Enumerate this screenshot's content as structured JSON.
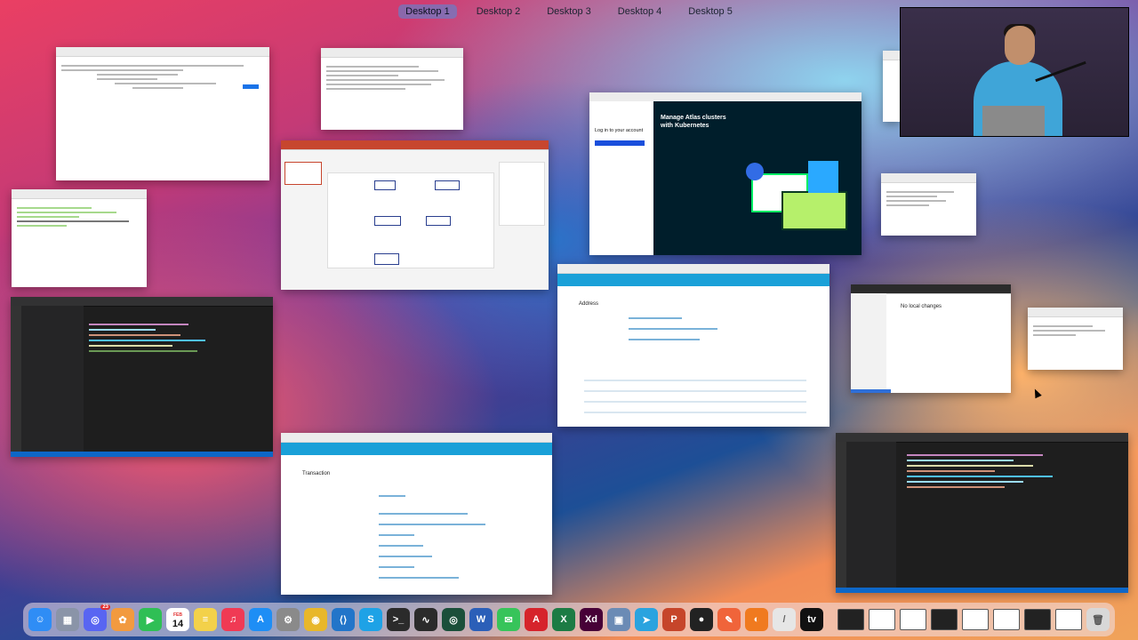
{
  "spaces": [
    "Desktop 1",
    "Desktop 2",
    "Desktop 3",
    "Desktop 4",
    "Desktop 5"
  ],
  "active_space": "Desktop 1",
  "windows": {
    "atlas": {
      "heading": "Manage Atlas clusters with Kubernetes",
      "login": "Log in to your account"
    },
    "address": {
      "title": "Address"
    },
    "transaction": {
      "title": "Transaction"
    },
    "vcs": {
      "title": "No local changes"
    }
  },
  "dock": {
    "calendar_month": "FEB",
    "calendar_day": "14",
    "discord_badge": "23",
    "apps": [
      {
        "name": "finder-icon",
        "glyph": "☺",
        "color": "#2f8df5"
      },
      {
        "name": "launchpad-icon",
        "glyph": "▦",
        "color": "#8a94a8"
      },
      {
        "name": "discord-icon",
        "glyph": "◎",
        "color": "#5865f2"
      },
      {
        "name": "photos-icon",
        "glyph": "✿",
        "color": "#f29a3f"
      },
      {
        "name": "facetime-icon",
        "glyph": "▶",
        "color": "#2fbf55"
      },
      {
        "name": "calendar-icon",
        "glyph": "",
        "color": "#ffffff"
      },
      {
        "name": "notes-icon",
        "glyph": "≡",
        "color": "#f3d14a"
      },
      {
        "name": "music-icon",
        "glyph": "♫",
        "color": "#f03a54"
      },
      {
        "name": "appstore-icon",
        "glyph": "A",
        "color": "#1e8ef5"
      },
      {
        "name": "settings-icon",
        "glyph": "⚙",
        "color": "#8a8a8a"
      },
      {
        "name": "chrome-icon",
        "glyph": "◉",
        "color": "#e8b72a"
      },
      {
        "name": "vscode-icon",
        "glyph": "⟨⟩",
        "color": "#2275c9"
      },
      {
        "name": "skype-icon",
        "glyph": "S",
        "color": "#1ea2e6"
      },
      {
        "name": "terminal-icon",
        "glyph": ">_",
        "color": "#2b2b2b"
      },
      {
        "name": "activity-monitor-icon",
        "glyph": "∿",
        "color": "#2b2b2b"
      },
      {
        "name": "compass-icon",
        "glyph": "◎",
        "color": "#1b4f3a"
      },
      {
        "name": "word-icon",
        "glyph": "W",
        "color": "#2b5fb8"
      },
      {
        "name": "messages-icon",
        "glyph": "✉",
        "color": "#37c45a"
      },
      {
        "name": "acrobat-icon",
        "glyph": "A",
        "color": "#d6232b"
      },
      {
        "name": "excel-icon",
        "glyph": "X",
        "color": "#1d7b44"
      },
      {
        "name": "xd-icon",
        "glyph": "Xd",
        "color": "#470137"
      },
      {
        "name": "preview-icon",
        "glyph": "▣",
        "color": "#6b8bb5"
      },
      {
        "name": "telegram-icon",
        "glyph": "➤",
        "color": "#2aa3df"
      },
      {
        "name": "powerpoint-icon",
        "glyph": "P",
        "color": "#c6452a"
      },
      {
        "name": "github-icon",
        "glyph": "●",
        "color": "#222222"
      },
      {
        "name": "postman-icon",
        "glyph": "✎",
        "color": "#f0643a"
      },
      {
        "name": "firefox-icon",
        "glyph": "◐",
        "color": "#f07a1f"
      },
      {
        "name": "sketch-icon",
        "glyph": "/",
        "color": "#e6e6e6"
      },
      {
        "name": "appletv-icon",
        "glyph": "tv",
        "color": "#111111"
      }
    ]
  }
}
